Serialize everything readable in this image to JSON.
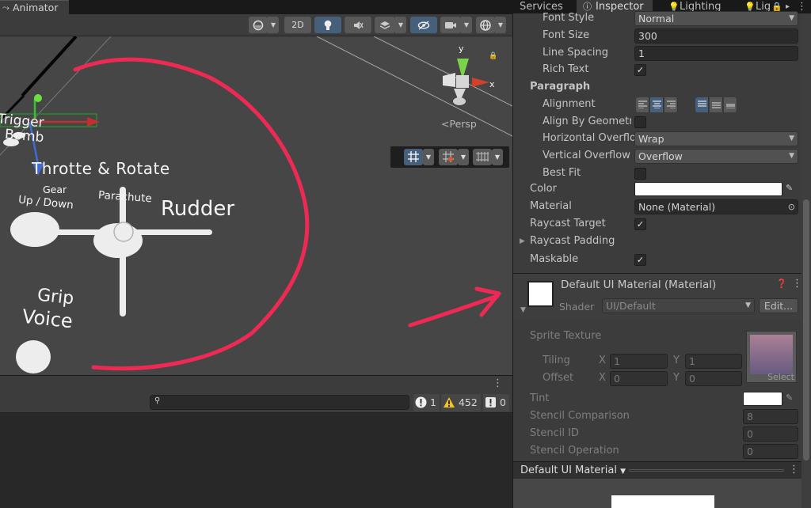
{
  "left_panel": {
    "tab_title": "Animator",
    "toolbar": {
      "mode_2d": "2D"
    },
    "gizmo": {
      "axis_x": "x",
      "axis_y": "y",
      "persp_label": "<Persp"
    },
    "scene_labels": {
      "trigger": "Trigger",
      "bomb": "Bomb",
      "throttle": "Throtte & Rotate",
      "gear": "Gear",
      "up_down": "Up / Down",
      "parachute": "Parachute",
      "rudder": "Rudder",
      "grip": "Grip",
      "voice": "Voice"
    },
    "console": {
      "search_value": "",
      "error_count": "1",
      "warning_count": "452",
      "message_count": "0"
    }
  },
  "inspector": {
    "tabs": [
      "Services",
      "Inspector",
      "Lighting",
      "Lig"
    ],
    "text": {
      "font_style_label": "Font Style",
      "font_style_value": "Normal",
      "font_size_label": "Font Size",
      "font_size_value": "300",
      "line_spacing_label": "Line Spacing",
      "line_spacing_value": "1",
      "rich_text_label": "Rich Text",
      "rich_text_checked": "✓",
      "paragraph_header": "Paragraph",
      "alignment_label": "Alignment",
      "align_by_geometry_label": "Align By Geometry",
      "horizontal_overflow_label": "Horizontal Overflo",
      "horizontal_overflow_value": "Wrap",
      "vertical_overflow_label": "Vertical Overflow",
      "vertical_overflow_value": "Overflow",
      "best_fit_label": "Best Fit"
    },
    "graphic": {
      "color_label": "Color",
      "color_value": "#ffffff",
      "material_label": "Material",
      "material_value": "None (Material)",
      "raycast_target_label": "Raycast Target",
      "raycast_target_checked": "✓",
      "raycast_padding_label": "Raycast Padding",
      "maskable_label": "Maskable",
      "maskable_checked": "✓"
    },
    "material_component": {
      "title": "Default UI Material (Material)",
      "shader_label": "Shader",
      "shader_value": "UI/Default",
      "edit_button": "Edit...",
      "sprite_texture_label": "Sprite Texture",
      "select_label": "Select",
      "tiling_label": "Tiling",
      "offset_label": "Offset",
      "x_label": "X",
      "y_label": "Y",
      "tiling_x": "1",
      "tiling_y": "1",
      "offset_x": "0",
      "offset_y": "0",
      "tint_label": "Tint",
      "stencil_comparison_label": "Stencil Comparison",
      "stencil_comparison_value": "8",
      "stencil_id_label": "Stencil ID",
      "stencil_id_value": "0",
      "stencil_operation_label": "Stencil Operation",
      "stencil_operation_value": "0"
    },
    "preview": {
      "title": "Default UI Material"
    }
  },
  "colors": {
    "annotation_red": "#ee2a54",
    "active_button_blue": "#46607c",
    "warning_yellow": "#f3c220"
  }
}
